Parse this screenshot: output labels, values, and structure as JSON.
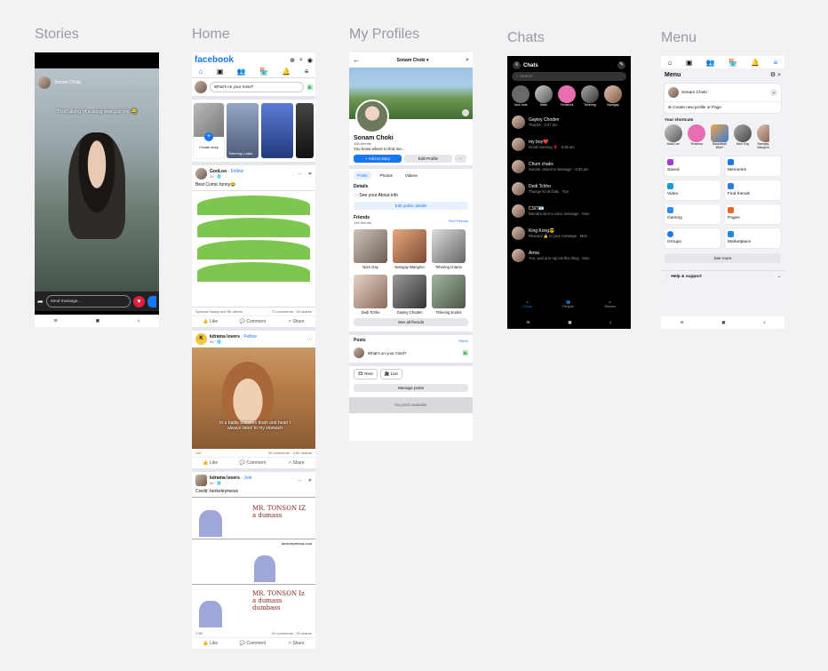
{
  "columns": [
    "Stories",
    "Home",
    "My Profiles",
    "Chats",
    "Menu"
  ],
  "stories": {
    "username": "Sonam Choki",
    "caption": "ThisTalking of a song was just me 😂",
    "send_placeholder": "Send message..."
  },
  "home": {
    "logo": "facebook",
    "mind_placeholder": "What's on your mind?",
    "create_story": "Create story",
    "story_names": [
      "Create story",
      "Tshering Ludan",
      "",
      ""
    ],
    "post1": {
      "author": "GooLoo",
      "follow": "Follow",
      "time": "2d · 🌐",
      "text": "Best Comic funny😂",
      "reactions": "Sylvana Haany and 5K others",
      "comments": "73 comments",
      "shares": "33 shares"
    },
    "post2": {
      "author": "kdrama lovers",
      "follow": "Follow",
      "time": "6d · 🌐",
      "avatar_letter": "K",
      "overlay": "In a battle between brain and heart I always listen to my stomach",
      "reactions": "11K",
      "comments": "96 comments",
      "shares": "3.6K shares"
    },
    "post3": {
      "author": "kdrama lovers",
      "join": "Join",
      "time": "6d · 🌐",
      "text": "Credit: berkeleymews",
      "panel1": "MR. TONSON IZ a dumass",
      "site": "berkeleymews.com",
      "panel3": "MR. TONSON Iz a dumass dumbass",
      "reactions": "2.8K",
      "comments": "42 comments",
      "shares": "32 shares"
    },
    "like": "Like",
    "comment": "Comment",
    "share": "Share"
  },
  "profile": {
    "title": "Sonam Choki ▾",
    "name": "Sonam Choki",
    "friends_count": "165 friends",
    "bio": "You know where to find me...",
    "add_story": "+ Add to story",
    "edit_profile": "Edit Profile",
    "tabs": [
      "Posts",
      "Photos",
      "Videos"
    ],
    "details": "Details",
    "see_about": "See your About info",
    "edit_public": "Edit public details",
    "friends_title": "Friends",
    "friends_sub": "165 friends",
    "find_friends": "Find Friends",
    "friends": [
      "Nom Gay",
      "Namgay Wangmo",
      "Tshering Lhamo",
      "Dedi Tchho",
      "Gayley Choden",
      "Tshering Eudes"
    ],
    "see_all": "See all friends",
    "posts_title": "Posts",
    "filters": "Filters",
    "mind": "What's on your mind?",
    "reel": "Reel",
    "live": "Live",
    "manage_posts": "Manage posts",
    "no_posts": "No posts available"
  },
  "chats": {
    "title": "Chats",
    "search": "Search",
    "story_names": [
      "Your note",
      "Mark",
      "Tenzema",
      "Tshering",
      "Namgay"
    ],
    "rows": [
      {
        "name": "Gayley Choden",
        "msg": "Thanks · 2:47 pm"
      },
      {
        "name": "my boy❤️",
        "msg": "Good morning 🌹 · 8:35 am"
      },
      {
        "name": "Chum chaks",
        "msg": "Sonam unsent a message · 8:35 pm"
      },
      {
        "name": "Dedi Tchho",
        "msg": "Thange ko its faltu · Tue"
      },
      {
        "name": "CSIT📧",
        "msg": "Namdra sent a voice message · Mon"
      },
      {
        "name": "King Kong😎",
        "msg": "Reacted 👍 to your message · Mon"
      },
      {
        "name": "Arma",
        "msg": "You: wait arm ngi tok this thing · Mon"
      }
    ],
    "tabs": [
      "Chats",
      "People",
      "Stories"
    ]
  },
  "menu": {
    "title": "Menu",
    "profile_name": "Sonam Choki",
    "create_profile": "Create new profile or Page",
    "shortcuts_title": "Your shortcuts",
    "shortcuts": [
      "Mark Lee",
      "Tenzema",
      "Basketball BDaY",
      "Nom Gay",
      "Namgay Wangmo"
    ],
    "cards": [
      "Saved",
      "Memories",
      "Video",
      "Find friends",
      "Gaming",
      "Pages",
      "Groups",
      "Marketplace"
    ],
    "see_more": "See more",
    "help": "Help & support"
  },
  "colors": {
    "fb_blue": "#1877f2",
    "like_red": "#e41e3f",
    "dark": "#000000",
    "hill_green": "#7fc64f"
  }
}
